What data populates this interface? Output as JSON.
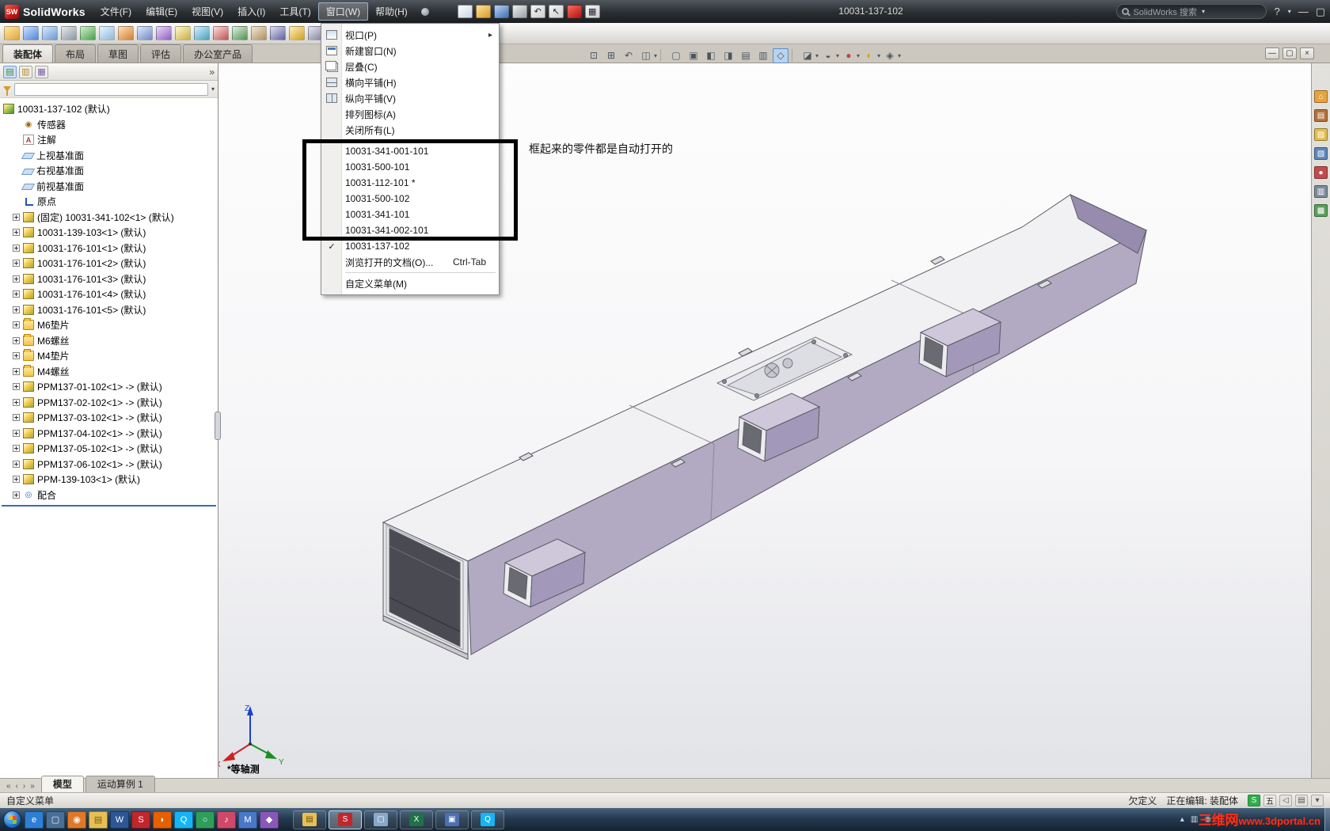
{
  "titlebar": {
    "app_name": "SolidWorks",
    "logo_glyph": "SW",
    "menus": [
      {
        "label": "文件(F)"
      },
      {
        "label": "编辑(E)"
      },
      {
        "label": "视图(V)"
      },
      {
        "label": "插入(I)"
      },
      {
        "label": "工具(T)"
      },
      {
        "label": "窗口(W)",
        "active": true
      },
      {
        "label": "帮助(H)"
      }
    ],
    "quick_icons": [
      {
        "name": "new-document",
        "c1": "#ffffff",
        "c2": "#c8d4e2"
      },
      {
        "name": "open-document",
        "c1": "#ffe39a",
        "c2": "#d89b2c",
        "caret": true
      },
      {
        "name": "save-document",
        "c1": "#bcd4f2",
        "c2": "#3f6fb5",
        "caret": true
      },
      {
        "name": "print-document",
        "c1": "#eeeeee",
        "c2": "#9aa0a8",
        "caret": true
      },
      {
        "name": "undo",
        "glyph": "↶",
        "c1": "#f4f4f4",
        "c2": "#cfcfcf",
        "caret": true
      },
      {
        "name": "select",
        "glyph": "↖",
        "c1": "#f4f4f4",
        "c2": "#cfcfcf",
        "caret": true
      },
      {
        "name": "rebuild-indicator",
        "c1": "#ff6a5a",
        "c2": "#b01414"
      },
      {
        "name": "options",
        "glyph": "▦",
        "c1": "#f4f4f4",
        "c2": "#cfcfcf",
        "caret": true
      }
    ],
    "document_title": "10031-137-102",
    "search_text": "SolidWorks 搜索",
    "help_label": "?",
    "win_min": "—",
    "win_restore": "▢"
  },
  "toolbar2": [
    {
      "name": "insert-components",
      "c1": "#ffe9a8",
      "c2": "#e0a43c",
      "caret": true
    },
    {
      "name": "mate",
      "c1": "#cfe2ff",
      "c2": "#4f86d8"
    },
    {
      "name": "linear-component-pattern",
      "c1": "#d8e8ff",
      "c2": "#6a9ad0",
      "caret": true
    },
    {
      "name": "smart-fasteners",
      "c1": "#e8e8e8",
      "c2": "#8898a8"
    },
    {
      "name": "move-component",
      "c1": "#d0f0d0",
      "c2": "#4aa04a",
      "caret": true
    },
    {
      "name": "show-hidden-components",
      "c1": "#e8f4ff",
      "c2": "#90b8d8"
    },
    {
      "name": "assembly-features",
      "c1": "#ffe0c0",
      "c2": "#d08030",
      "caret": true
    },
    {
      "name": "reference-geometry",
      "c1": "#e0e8f8",
      "c2": "#7088c8",
      "caret": true
    },
    {
      "name": "new-motion-study",
      "c1": "#e8d8f8",
      "c2": "#9060c0"
    },
    {
      "name": "bill-of-materials",
      "c1": "#fff8d0",
      "c2": "#c8b040"
    },
    {
      "name": "exploded-view",
      "c1": "#d8f0f8",
      "c2": "#48a0c0"
    },
    {
      "name": "explode-line-sketch",
      "c1": "#f8e0e0",
      "c2": "#c05050"
    },
    {
      "name": "interference-detection",
      "c1": "#e0f0e0",
      "c2": "#509050"
    },
    {
      "name": "clearance-verification",
      "c1": "#f0e8d8",
      "c2": "#b09060"
    },
    {
      "name": "hole-alignment",
      "c1": "#e0e0f0",
      "c2": "#6060a0"
    },
    {
      "name": "measure",
      "c1": "#fff0c0",
      "c2": "#d0a020"
    },
    {
      "name": "mass-properties",
      "c1": "#e8e8f0",
      "c2": "#8080a0"
    },
    {
      "name": "section-properties",
      "c1": "#d8e8e8",
      "c2": "#509090"
    },
    {
      "name": "sensor",
      "c1": "#f0d8d8",
      "c2": "#a05050"
    },
    {
      "name": "curves",
      "c1": "#d8e0f0",
      "c2": "#5070b0"
    },
    {
      "name": "instant3d",
      "c1": "#ffe8d0",
      "c2": "#e09040",
      "caret": true
    }
  ],
  "command_tabs": [
    {
      "label": "装配体",
      "active": true
    },
    {
      "label": "布局"
    },
    {
      "label": "草图"
    },
    {
      "label": "评估"
    },
    {
      "label": "办公室产品"
    }
  ],
  "headsup": [
    {
      "name": "zoom-fit",
      "glyph": "⊡"
    },
    {
      "name": "zoom-area",
      "glyph": "⊞"
    },
    {
      "name": "previous-view",
      "glyph": "↶"
    },
    {
      "name": "section-view",
      "glyph": "◫",
      "caret": true
    },
    {
      "sep": true
    },
    {
      "name": "front-view",
      "glyph": "▢"
    },
    {
      "name": "back-view",
      "glyph": "▣"
    },
    {
      "name": "left-view",
      "glyph": "◧"
    },
    {
      "name": "right-view",
      "glyph": "◨"
    },
    {
      "name": "top-view",
      "glyph": "▤"
    },
    {
      "name": "bottom-view",
      "glyph": "▥"
    },
    {
      "name": "isometric-view",
      "glyph": "◇",
      "pressed": true
    },
    {
      "sep": true
    },
    {
      "name": "display-style",
      "glyph": "◪",
      "caret": true
    },
    {
      "name": "hide-show-items",
      "glyph": "◒",
      "caret": true
    },
    {
      "name": "edit-appearance",
      "glyph": "●",
      "fg": "#c04848",
      "caret": true
    },
    {
      "name": "apply-scene",
      "glyph": "◐",
      "fg": "#d09c20",
      "caret": true
    },
    {
      "name": "view-settings",
      "glyph": "◈",
      "caret": true
    }
  ],
  "doc_controls": {
    "minimize": "—",
    "restore": "▢",
    "close": "×"
  },
  "window_menu": {
    "items": [
      {
        "label": "视口(P)",
        "icon": "menu-viewport",
        "submenu": true
      },
      {
        "label": "新建窗口(N)",
        "icon": "menu-new-window"
      },
      {
        "label": "层叠(C)",
        "icon": "menu-cascade"
      },
      {
        "label": "横向平铺(H)",
        "icon": "menu-tile-h"
      },
      {
        "label": "纵向平铺(V)",
        "icon": "menu-tile-v"
      },
      {
        "label": "排列图标(A)"
      },
      {
        "label": "关闭所有(L)"
      },
      {
        "sep": true
      },
      {
        "label": "10031-341-001-101"
      },
      {
        "label": "10031-500-101"
      },
      {
        "label": "10031-112-101 *"
      },
      {
        "label": "10031-500-102"
      },
      {
        "label": "10031-341-101"
      },
      {
        "label": "10031-341-002-101"
      },
      {
        "label": "10031-137-102",
        "checked": true
      },
      {
        "label": "浏览打开的文档(O)...",
        "shortcut": "Ctrl-Tab"
      },
      {
        "sep": true
      },
      {
        "label": "自定义菜单(M)"
      }
    ]
  },
  "annotation": {
    "note": "框起来的零件都是自动打开的"
  },
  "panel": {
    "tabs": [
      {
        "name": "featuremanager-tree",
        "glyph": "▤",
        "fg": "#3c8a3c",
        "active": true
      },
      {
        "name": "property-manager",
        "glyph": "▥",
        "fg": "#b58a2a"
      },
      {
        "name": "configuration-manager",
        "glyph": "▦",
        "fg": "#7a5ab0"
      }
    ],
    "expand_glyph": "»",
    "filter_caret": "▾"
  },
  "feature_tree": {
    "root": {
      "label": "10031-137-102 (默认)",
      "icon": "assembly"
    },
    "items": [
      {
        "label": "传感器",
        "icon": "sensors"
      },
      {
        "label": "注解",
        "icon": "annotations"
      },
      {
        "label": "上视基准面",
        "icon": "plane"
      },
      {
        "label": "右视基准面",
        "icon": "plane"
      },
      {
        "label": "前视基准面",
        "icon": "plane"
      },
      {
        "label": "原点",
        "icon": "origin"
      },
      {
        "label": "(固定) 10031-341-102<1> (默认)",
        "icon": "component",
        "expand": true
      },
      {
        "label": "10031-139-103<1> (默认)",
        "icon": "component",
        "expand": true
      },
      {
        "label": "10031-176-101<1> (默认)",
        "icon": "component",
        "expand": true
      },
      {
        "label": "10031-176-101<2> (默认)",
        "icon": "component",
        "expand": true
      },
      {
        "label": "10031-176-101<3> (默认)",
        "icon": "component",
        "expand": true
      },
      {
        "label": "10031-176-101<4> (默认)",
        "icon": "component",
        "expand": true
      },
      {
        "label": "10031-176-101<5> (默认)",
        "icon": "component",
        "expand": true
      },
      {
        "label": "M6垫片",
        "icon": "folder",
        "expand": true
      },
      {
        "label": "M6螺丝",
        "icon": "folder",
        "expand": true
      },
      {
        "label": "M4垫片",
        "icon": "folder",
        "expand": true
      },
      {
        "label": "M4螺丝",
        "icon": "folder",
        "expand": true
      },
      {
        "label": "PPM137-01-102<1> -> (默认)",
        "icon": "component",
        "expand": true
      },
      {
        "label": "PPM137-02-102<1> -> (默认)",
        "icon": "component",
        "expand": true
      },
      {
        "label": "PPM137-03-102<1> -> (默认)",
        "icon": "component",
        "expand": true
      },
      {
        "label": "PPM137-04-102<1> -> (默认)",
        "icon": "component",
        "expand": true
      },
      {
        "label": "PPM137-05-102<1> -> (默认)",
        "icon": "component",
        "expand": true
      },
      {
        "label": "PPM137-06-102<1> -> (默认)",
        "icon": "component",
        "expand": true
      },
      {
        "label": "PPM-139-103<1> (默认)",
        "icon": "component",
        "expand": true
      },
      {
        "label": "配合",
        "icon": "mates",
        "expand": true
      }
    ]
  },
  "viewport": {
    "view_label": "*等轴测",
    "triad": {
      "x": "X",
      "y": "Y",
      "z": "Z"
    }
  },
  "taskpane": [
    {
      "name": "solidworks-resources",
      "glyph": "⌂",
      "bg": "#e8a33c"
    },
    {
      "name": "design-library",
      "glyph": "▤",
      "bg": "#b5713a"
    },
    {
      "name": "file-explorer",
      "glyph": "▨",
      "bg": "#e3bd4e"
    },
    {
      "name": "view-palette",
      "glyph": "▧",
      "bg": "#5d87b8"
    },
    {
      "name": "appearances-scenes",
      "glyph": "●",
      "bg": "#c24b4b"
    },
    {
      "name": "custom-properties",
      "glyph": "▥",
      "bg": "#7d8b99"
    },
    {
      "name": "document-recovery",
      "glyph": "▩",
      "bg": "#5aa05a"
    }
  ],
  "doc_tabs": {
    "nav": [
      {
        "glyph": "«",
        "name": "first-tab"
      },
      {
        "glyph": "‹",
        "name": "prev-tab"
      },
      {
        "glyph": "›",
        "name": "next-tab"
      },
      {
        "glyph": "»",
        "name": "last-tab"
      }
    ],
    "tabs": [
      {
        "label": "模型",
        "active": true
      },
      {
        "label": "运动算例 1"
      }
    ]
  },
  "status_bar": {
    "left": "自定义菜单",
    "constraint_state": "欠定义",
    "editing": "正在编辑: 装配体",
    "icons": [
      {
        "name": "tray-stock-app",
        "glyph": "S",
        "c1": "#2fae4a",
        "fg": "#fff"
      },
      {
        "name": "input-method-indicator",
        "glyph": "五",
        "c1": "#eceae4",
        "fg": "#222"
      },
      {
        "name": "langbar-handwriting",
        "glyph": "◁",
        "c1": "#e4e2dc",
        "fg": "#555"
      },
      {
        "name": "langbar-keyboard",
        "glyph": "▤",
        "c1": "#e4e2dc",
        "fg": "#555"
      },
      {
        "name": "langbar-options",
        "glyph": "▾",
        "c1": "#e4e2dc",
        "fg": "#555"
      }
    ]
  },
  "taskbar": {
    "apps": [
      {
        "name": "internet-explorer",
        "glyph": "e",
        "c1": "#2d7fd6",
        "fg": "#fff"
      },
      {
        "name": "show-desktop-shortcut",
        "glyph": "▢",
        "c1": "#4a6f94",
        "fg": "#e8f0f8"
      },
      {
        "name": "media-player",
        "glyph": "◉",
        "c1": "#e07828",
        "fg": "#fff"
      },
      {
        "name": "folder-shortcut",
        "glyph": "▤",
        "c1": "#e7c054",
        "fg": "#7a5a10"
      },
      {
        "name": "word",
        "glyph": "W",
        "c1": "#2b5797",
        "fg": "#fff"
      },
      {
        "name": "solidworks-shortcut",
        "glyph": "S",
        "c1": "#c0272d",
        "fg": "#fff"
      },
      {
        "name": "firefox",
        "glyph": "◗",
        "c1": "#e66000",
        "fg": "#fff"
      },
      {
        "name": "qq",
        "glyph": "Q",
        "c1": "#15b5f5",
        "fg": "#fff"
      },
      {
        "name": "browser-360",
        "glyph": "○",
        "c1": "#2e9e5b",
        "fg": "#fff"
      },
      {
        "name": "music-player",
        "glyph": "♪",
        "c1": "#d04868",
        "fg": "#fff"
      },
      {
        "name": "mail-client",
        "glyph": "M",
        "c1": "#4878c8",
        "fg": "#fff"
      },
      {
        "name": "utility-tool",
        "glyph": "◆",
        "c1": "#8858b8",
        "fg": "#fff"
      }
    ],
    "windows": [
      {
        "name": "explorer-window",
        "glyph": "▤",
        "c1": "#e7c054",
        "fg": "#6a4a10"
      },
      {
        "name": "solidworks-window",
        "glyph": "S",
        "c1": "#c0272d",
        "fg": "#fff",
        "active": true
      },
      {
        "name": "notepad-window",
        "glyph": "▢",
        "c1": "#88a8c8",
        "fg": "#fff"
      },
      {
        "name": "excel-window",
        "glyph": "X",
        "c1": "#1f7246",
        "fg": "#fff"
      },
      {
        "name": "viewer-window",
        "glyph": "▣",
        "c1": "#4a6fb5",
        "fg": "#fff"
      },
      {
        "name": "qq-window",
        "glyph": "Q",
        "c1": "#15b5f5",
        "fg": "#fff"
      }
    ],
    "tray": [
      {
        "name": "tray-up-arrow",
        "glyph": "▴"
      },
      {
        "name": "tray-network",
        "glyph": "▥"
      },
      {
        "name": "tray-volume",
        "glyph": "◉"
      }
    ]
  },
  "watermark": {
    "brand": "三维网",
    "url": "www.3dportal.cn"
  }
}
